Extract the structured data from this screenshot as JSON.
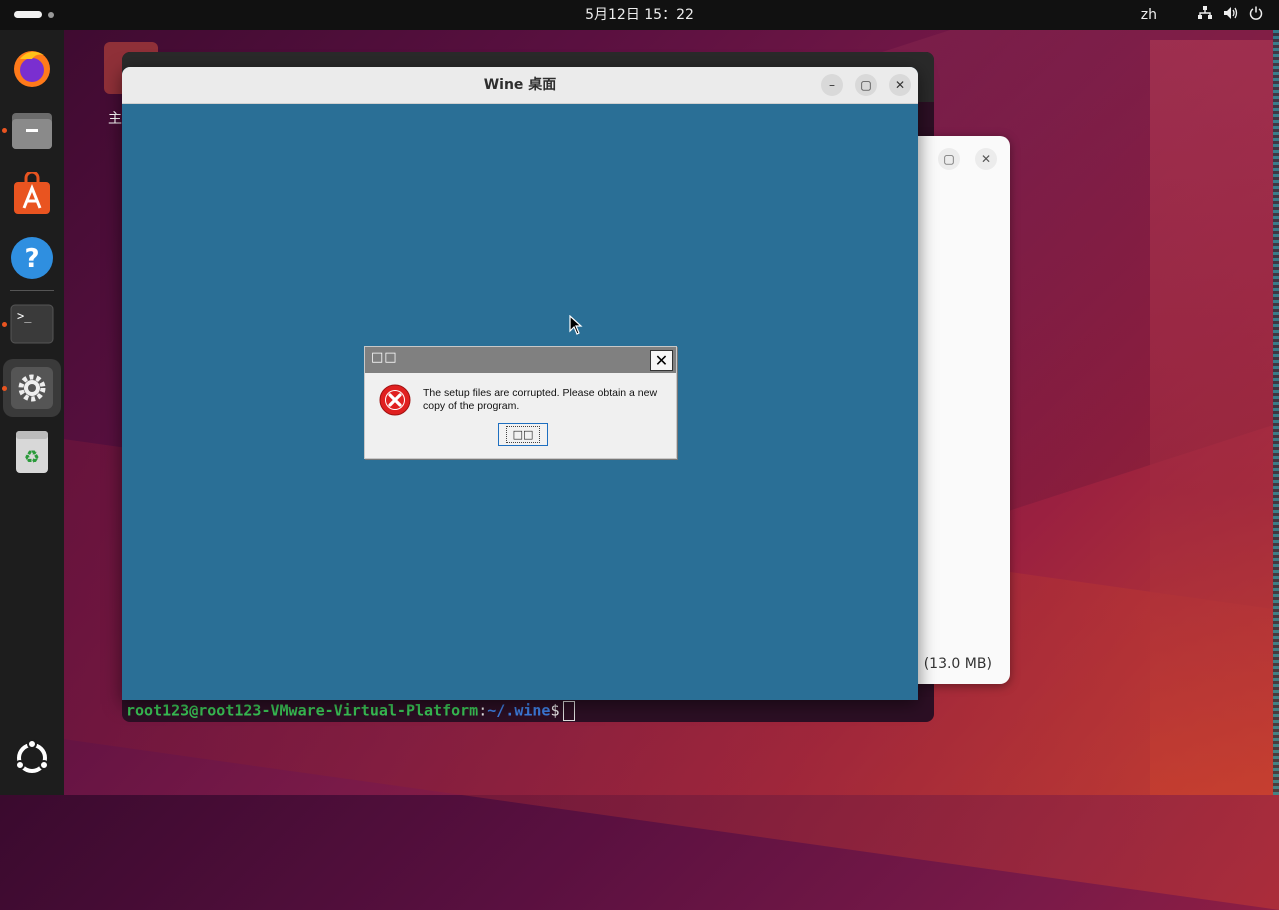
{
  "topbar": {
    "clock": "5月12日 15：22",
    "input_lang": "zh"
  },
  "dock": {
    "items": [
      {
        "name": "firefox",
        "running": false
      },
      {
        "name": "files",
        "running": true
      },
      {
        "name": "app-center",
        "running": false
      },
      {
        "name": "help",
        "running": false
      },
      {
        "name": "terminal",
        "running": true
      },
      {
        "name": "settings",
        "running": true,
        "active": true
      },
      {
        "name": "trash",
        "running": false
      },
      {
        "name": "show-apps",
        "running": false
      }
    ]
  },
  "desktop": {
    "folder_label": "主"
  },
  "terminal": {
    "user_host": "root123@root123-VMware-Virtual-Platform",
    "separator": ":",
    "path": "~/.wine",
    "prompt": "$"
  },
  "background_window": {
    "size_text": "” (13.0 MB)"
  },
  "wine_window": {
    "title": "Wine 桌面"
  },
  "dialog": {
    "title": "□□",
    "message": "The setup files are corrupted. Please obtain a new copy of the program.",
    "ok_label": "□□"
  },
  "colors": {
    "wine_desktop": "#2a6f96",
    "error_icon": "#e02020",
    "ubuntu_orange": "#e95420"
  }
}
